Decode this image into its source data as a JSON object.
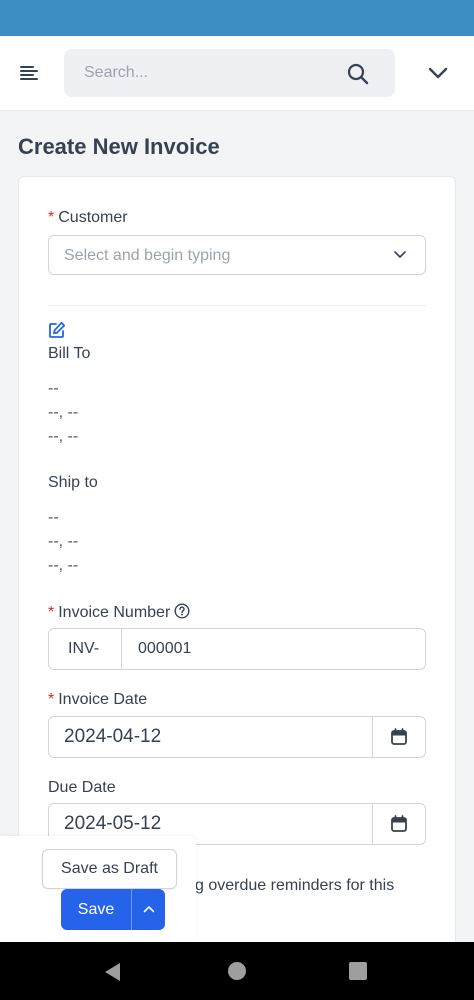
{
  "header": {
    "search_placeholder": "Search..."
  },
  "page": {
    "title": "Create New Invoice"
  },
  "customer": {
    "required_mark": "*",
    "label": "Customer",
    "placeholder": "Select and begin typing"
  },
  "bill_to": {
    "label": "Bill To",
    "lines": [
      "--",
      "--, --",
      "--, --"
    ]
  },
  "ship_to": {
    "label": "Ship to",
    "lines": [
      "--",
      "--, --",
      "--, --"
    ]
  },
  "invoice_number": {
    "required_mark": "*",
    "label": "Invoice Number",
    "prefix": "INV-",
    "value": "000001"
  },
  "invoice_date": {
    "required_mark": "*",
    "label": "Invoice Date",
    "value": "2024-04-12"
  },
  "due_date": {
    "label": "Due Date",
    "value": "2024-05-12"
  },
  "reminder": {
    "visible_text": "g overdue reminders for this"
  },
  "actions": {
    "draft_label": "Save as Draft",
    "save_label": "Save"
  },
  "colors": {
    "status_bar": "#3d8fc3",
    "primary": "#2563eb",
    "required": "#dc2626"
  },
  "icons": [
    "menu-icon",
    "search-icon",
    "chevron-down-icon",
    "edit-icon",
    "help-icon",
    "calendar-icon",
    "chevron-up-icon",
    "back-icon",
    "home-icon",
    "recent-apps-icon"
  ]
}
